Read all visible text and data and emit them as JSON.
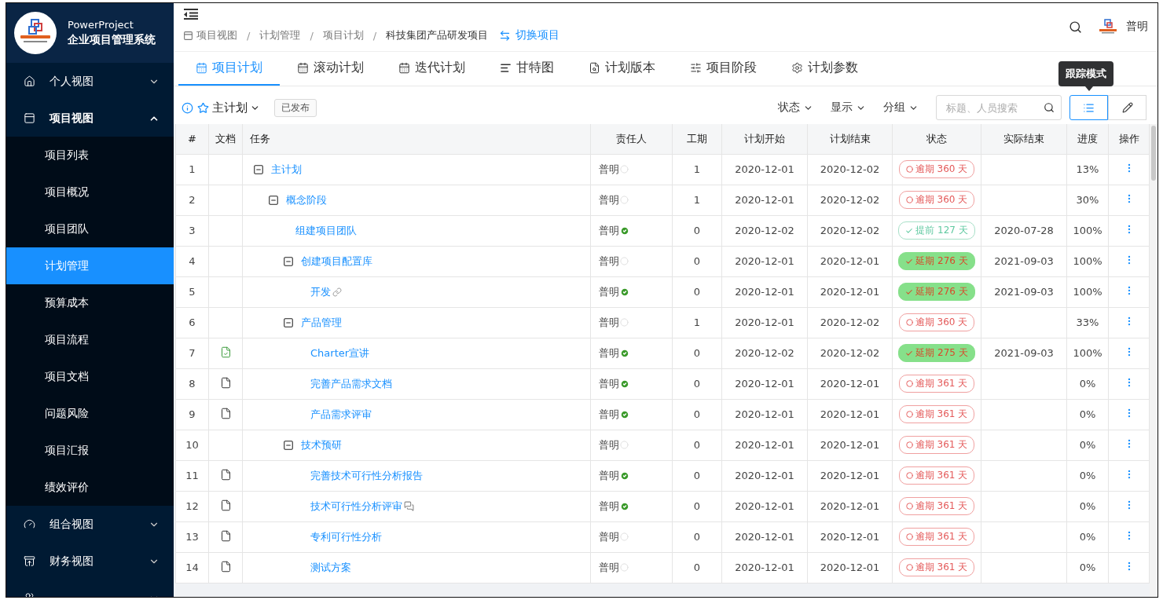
{
  "brand": {
    "name": "PowerProject",
    "subtitle": "企业项目管理系统"
  },
  "sidebar": {
    "items": [
      {
        "label": "个人视图",
        "kind": "home",
        "expanded": false
      },
      {
        "label": "项目视图",
        "kind": "panel",
        "expanded": true,
        "children": [
          {
            "label": "项目列表",
            "selected": false
          },
          {
            "label": "项目概况",
            "selected": false
          },
          {
            "label": "项目团队",
            "selected": false
          },
          {
            "label": "计划管理",
            "selected": true
          },
          {
            "label": "预算成本",
            "selected": false
          },
          {
            "label": "项目流程",
            "selected": false
          },
          {
            "label": "项目文档",
            "selected": false
          },
          {
            "label": "问题风险",
            "selected": false
          },
          {
            "label": "项目汇报",
            "selected": false
          },
          {
            "label": "绩效评价",
            "selected": false
          }
        ]
      },
      {
        "label": "组合视图",
        "kind": "gauge",
        "expanded": false
      },
      {
        "label": "财务视图",
        "kind": "money",
        "expanded": false
      },
      {
        "kind": "team",
        "expanded": false
      }
    ]
  },
  "breadcrumb": [
    {
      "label": "项目视图"
    },
    {
      "separator": "/",
      "label": "计划管理"
    },
    {
      "separator": "/",
      "label": "项目计划"
    },
    {
      "separator": "/",
      "label": "科技集团产品研发项目"
    }
  ],
  "switch_project": "切换项目",
  "user": {
    "name": "普明"
  },
  "tabs": [
    {
      "label": "项目计划",
      "kind": "calendar",
      "selected": true
    },
    {
      "label": "滚动计划",
      "kind": "calendar",
      "selected": false
    },
    {
      "label": "迭代计划",
      "kind": "calendar",
      "selected": false
    },
    {
      "label": "甘特图",
      "kind": "gantt",
      "selected": false
    },
    {
      "label": "计划版本",
      "kind": "version",
      "selected": false
    },
    {
      "label": "项目阶段",
      "kind": "sliders",
      "selected": false
    },
    {
      "label": "计划参数",
      "kind": "settings",
      "selected": false
    }
  ],
  "plan": {
    "name": "主计划",
    "badge": "已发布"
  },
  "filters": [
    "状态",
    "显示",
    "分组"
  ],
  "search": {
    "placeholder": "标题、人员搜索"
  },
  "view_modes": [
    {
      "kind": "track",
      "selected": true,
      "tooltip": "跟踪模式"
    },
    {
      "kind": "edit",
      "selected": false
    }
  ],
  "table": {
    "columns": [
      "#",
      "文档",
      "任务",
      "责任人",
      "工期",
      "计划开始",
      "计划结束",
      "状态",
      "实际结束",
      "进度",
      "操作"
    ],
    "rows": [
      {
        "no": "1",
        "task": "主计划",
        "owner": "普明",
        "owner_done": false,
        "duration": "1",
        "start": "2020-12-01",
        "end": "2020-12-02",
        "status": {
          "kind": "overdue",
          "text": "逾期 360 天"
        },
        "progress": "13%",
        "expanded": true,
        "children": [
          {
            "no": "2",
            "task": "概念阶段",
            "owner": "普明",
            "owner_done": false,
            "duration": "1",
            "start": "2020-12-01",
            "end": "2020-12-02",
            "status": {
              "kind": "overdue",
              "text": "逾期 360 天"
            },
            "progress": "30%",
            "expanded": true,
            "children": [
              {
                "no": "3",
                "task": "组建项目团队",
                "owner": "普明",
                "owner_done": true,
                "duration": "0",
                "start": "2020-12-02",
                "end": "2020-12-02",
                "status": {
                  "kind": "early",
                  "text": "提前 127 天"
                },
                "actual_end": "2020-07-28",
                "progress": "100%"
              },
              {
                "no": "4",
                "task": "创建项目配置库",
                "owner": "普明",
                "owner_done": false,
                "duration": "0",
                "start": "2020-12-01",
                "end": "2020-12-01",
                "status": {
                  "kind": "delayed",
                  "text": "延期 276 天"
                },
                "actual_end": "2021-09-03",
                "progress": "100%",
                "expanded": true,
                "children": [
                  {
                    "no": "5",
                    "task": "开发",
                    "attachment": {
                      "kind": "link"
                    },
                    "owner": "普明",
                    "owner_done": true,
                    "duration": "0",
                    "start": "2020-12-01",
                    "end": "2020-12-01",
                    "status": {
                      "kind": "delayed",
                      "text": "延期 276 天"
                    },
                    "actual_end": "2021-09-03",
                    "progress": "100%"
                  }
                ]
              },
              {
                "no": "6",
                "task": "产品管理",
                "owner": "普明",
                "owner_done": false,
                "duration": "1",
                "start": "2020-12-01",
                "end": "2020-12-02",
                "status": {
                  "kind": "overdue",
                  "text": "逾期 360 天"
                },
                "progress": "33%",
                "expanded": true,
                "children": [
                  {
                    "no": "7",
                    "doc": {
                      "kind": "approved"
                    },
                    "task": "Charter宣讲",
                    "owner": "普明",
                    "owner_done": true,
                    "duration": "0",
                    "start": "2020-12-02",
                    "end": "2020-12-02",
                    "status": {
                      "kind": "delayed",
                      "text": "延期 275 天"
                    },
                    "actual_end": "2021-09-03",
                    "progress": "100%"
                  },
                  {
                    "no": "8",
                    "doc": {
                      "kind": "file"
                    },
                    "task": "完善产品需求文档",
                    "owner": "普明",
                    "owner_done": true,
                    "duration": "0",
                    "start": "2020-12-01",
                    "end": "2020-12-01",
                    "status": {
                      "kind": "overdue",
                      "text": "逾期 361 天"
                    },
                    "progress": "0%"
                  },
                  {
                    "no": "9",
                    "doc": {
                      "kind": "file"
                    },
                    "task": "产品需求评审",
                    "owner": "普明",
                    "owner_done": true,
                    "duration": "0",
                    "start": "2020-12-01",
                    "end": "2020-12-01",
                    "status": {
                      "kind": "overdue",
                      "text": "逾期 361 天"
                    },
                    "progress": "0%"
                  }
                ]
              },
              {
                "no": "10",
                "task": "技术预研",
                "owner": "普明",
                "owner_done": false,
                "duration": "0",
                "start": "2020-12-01",
                "end": "2020-12-01",
                "status": {
                  "kind": "overdue",
                  "text": "逾期 361 天"
                },
                "progress": "0%",
                "expanded": true,
                "children": [
                  {
                    "no": "11",
                    "doc": {
                      "kind": "file"
                    },
                    "task": "完善技术可行性分析报告",
                    "owner": "普明",
                    "owner_done": true,
                    "duration": "0",
                    "start": "2020-12-01",
                    "end": "2020-12-01",
                    "status": {
                      "kind": "overdue",
                      "text": "逾期 361 天"
                    },
                    "progress": "0%"
                  },
                  {
                    "no": "12",
                    "doc": {
                      "kind": "file"
                    },
                    "task": "技术可行性分析评审",
                    "attachment": {
                      "kind": "comment"
                    },
                    "owner": "普明",
                    "owner_done": true,
                    "duration": "0",
                    "start": "2020-12-01",
                    "end": "2020-12-01",
                    "status": {
                      "kind": "overdue",
                      "text": "逾期 361 天"
                    },
                    "progress": "0%"
                  },
                  {
                    "no": "13",
                    "doc": {
                      "kind": "file"
                    },
                    "task": "专利可行性分析",
                    "owner": "普明",
                    "owner_done": false,
                    "duration": "0",
                    "start": "2020-12-01",
                    "end": "2020-12-01",
                    "status": {
                      "kind": "overdue",
                      "text": "逾期 361 天"
                    },
                    "progress": "0%"
                  },
                  {
                    "no": "14",
                    "doc": {
                      "kind": "file"
                    },
                    "task": "测试方案",
                    "owner": "普明",
                    "owner_done": false,
                    "duration": "0",
                    "start": "2020-12-01",
                    "end": "2020-12-01",
                    "status": {
                      "kind": "overdue",
                      "text": "逾期 361 天"
                    },
                    "progress": "0%"
                  }
                ]
              }
            ]
          }
        ]
      }
    ]
  }
}
